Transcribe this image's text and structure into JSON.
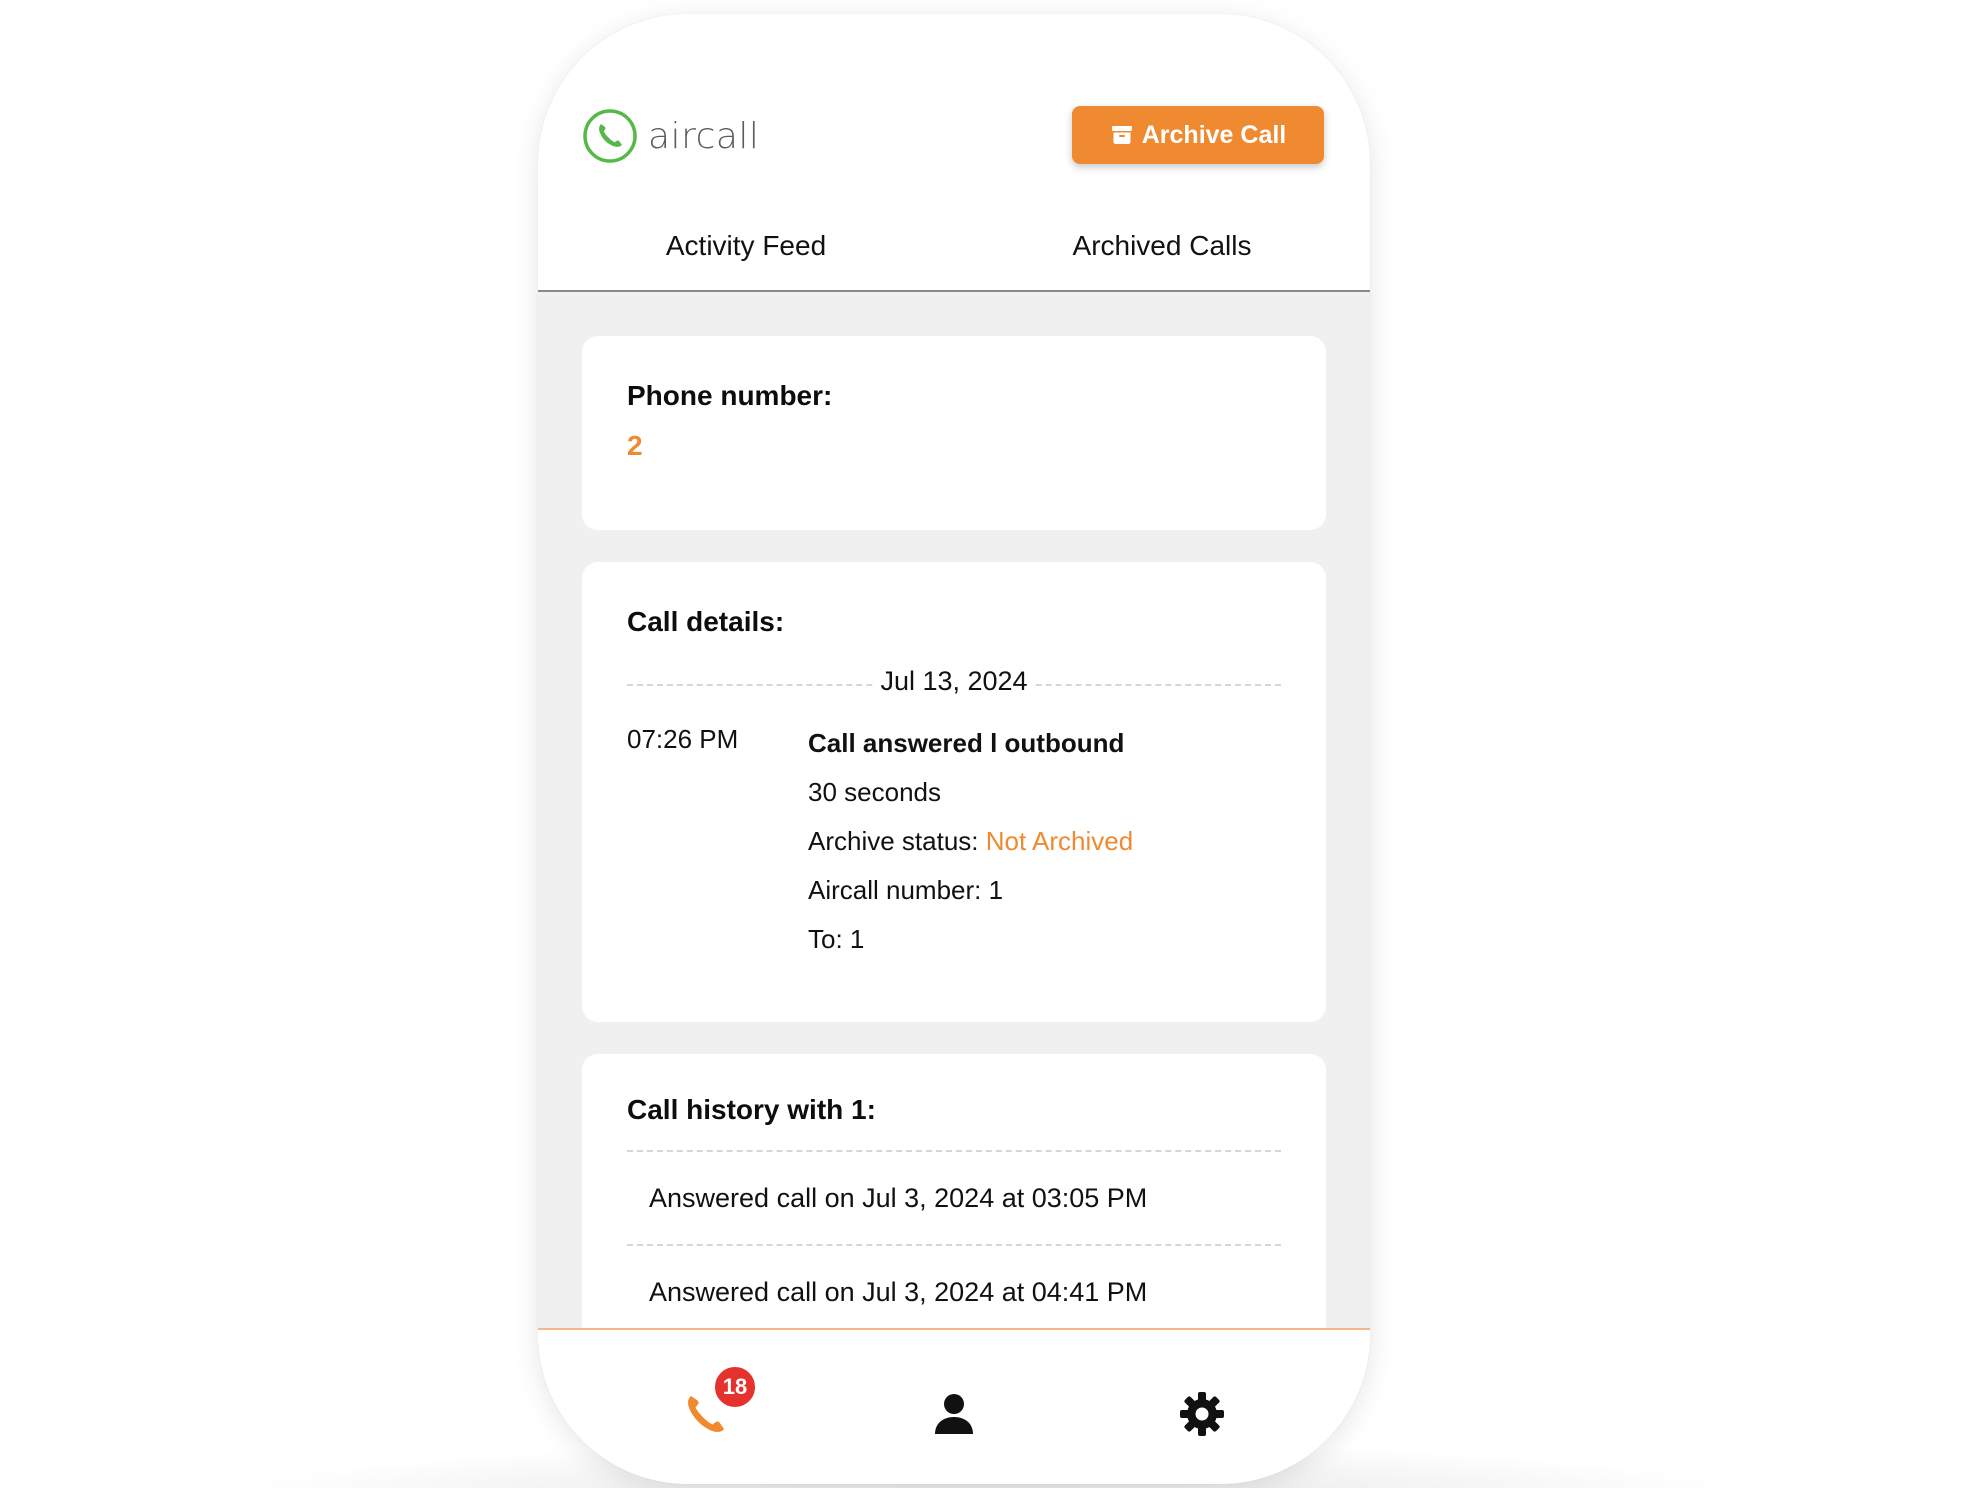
{
  "app": {
    "brand": "aircall",
    "brand_color": "#55b848",
    "accent_color": "#f08a30"
  },
  "header": {
    "archive_button": {
      "label": "Archive Call",
      "icon": "archive-box-icon"
    }
  },
  "tabs": [
    {
      "label": "Activity Feed"
    },
    {
      "label": "Archived Calls"
    }
  ],
  "phone_card": {
    "title": "Phone number:",
    "value": "2"
  },
  "call_details": {
    "title": "Call details:",
    "date": "Jul 13, 2024",
    "time": "07:26 PM",
    "summary": "Call answered l outbound",
    "duration": "30 seconds",
    "archive_status_label": "Archive status:",
    "archive_status_value": "Not Archived",
    "aircall_number": "Aircall number: 1",
    "to": "To: 1"
  },
  "call_history": {
    "title": "Call history with 1:",
    "items": [
      {
        "text": "Answered call on Jul 3, 2024 at 03:05 PM"
      },
      {
        "text": "Answered call on Jul 3, 2024 at 04:41 PM"
      }
    ]
  },
  "bottom_nav": {
    "items": [
      {
        "icon": "phone-icon",
        "color": "#f08a30",
        "badge": "18"
      },
      {
        "icon": "user-icon",
        "color": "#111111"
      },
      {
        "icon": "gear-icon",
        "color": "#111111"
      }
    ],
    "badge_color": "#e5322d"
  }
}
